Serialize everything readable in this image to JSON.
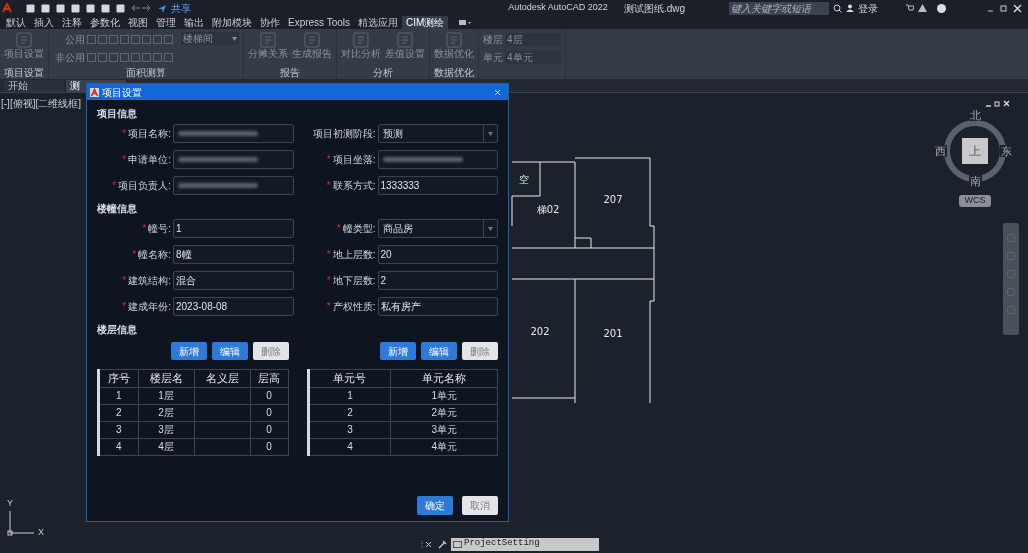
{
  "app": {
    "title": "Autodesk AutoCAD 2022",
    "file_name": "测试图纸.dwg",
    "share": "共享",
    "search": {
      "placeholder": "键入关键字或短语"
    },
    "login": "登录"
  },
  "ribbon_tabs": [
    {
      "label": "默认",
      "selected": false
    },
    {
      "label": "插入",
      "selected": false
    },
    {
      "label": "注释",
      "selected": false
    },
    {
      "label": "参数化",
      "selected": false
    },
    {
      "label": "视图",
      "selected": false
    },
    {
      "label": "管理",
      "selected": false
    },
    {
      "label": "输出",
      "selected": false
    },
    {
      "label": "附加模块",
      "selected": false
    },
    {
      "label": "协作",
      "selected": false
    },
    {
      "label": "Express Tools",
      "selected": false
    },
    {
      "label": "精选应用",
      "selected": false
    },
    {
      "label": "CIM测绘",
      "selected": true
    }
  ],
  "ribbon_panels": [
    {
      "kind": "buttons",
      "title": "项目设置",
      "buttons": [
        "项目设置"
      ]
    },
    {
      "kind": "area",
      "title": "面积测算",
      "rows": [
        "公用",
        "非公用"
      ],
      "dropdown": "楼梯间"
    },
    {
      "kind": "buttons",
      "title": "报告",
      "buttons": [
        "分摊关系",
        "生成报告"
      ]
    },
    {
      "kind": "buttons",
      "title": "分析",
      "buttons": [
        "对比分析",
        "差值设置"
      ]
    },
    {
      "kind": "buttons",
      "title": "数据优化",
      "buttons": [
        "数据优化"
      ]
    },
    {
      "kind": "selectors",
      "selectors": [
        {
          "label": "楼层",
          "value": "4层"
        },
        {
          "label": "单元",
          "value": "4单元"
        }
      ]
    }
  ],
  "file_tabs": [
    {
      "label": "开始",
      "selected": false
    },
    {
      "label": "测",
      "selected": true
    }
  ],
  "viewport_label": "[-][俯视][二维线框]",
  "drawing": {
    "rooms": [
      "空",
      "梯02",
      "207",
      "202",
      "201"
    ]
  },
  "viewcube": {
    "north": "北",
    "south": "南",
    "east": "东",
    "west": "西",
    "face": "上",
    "ucs": "WCS"
  },
  "dialog": {
    "title": "项目设置",
    "required_mark": "*",
    "sections": [
      {
        "title": "项目信息",
        "fields": [
          {
            "label": "项目名称:",
            "required": true,
            "kind": "blurred"
          },
          {
            "label": "项目初测阶段:",
            "required": false,
            "kind": "select",
            "value": "预测"
          },
          {
            "label": "申请单位:",
            "required": true,
            "kind": "blurred"
          },
          {
            "label": "项目坐落:",
            "required": true,
            "kind": "blurred"
          },
          {
            "label": "项目负责人:",
            "required": true,
            "kind": "blurred"
          },
          {
            "label": "联系方式:",
            "required": true,
            "kind": "text",
            "value": "1333333"
          }
        ]
      },
      {
        "title": "楼幢信息",
        "fields": [
          {
            "label": "幢号:",
            "required": true,
            "kind": "text",
            "value": "1"
          },
          {
            "label": "幢类型:",
            "required": true,
            "kind": "select",
            "value": "商品房"
          },
          {
            "label": "幢名称:",
            "required": true,
            "kind": "text",
            "value": "8幢"
          },
          {
            "label": "地上层数:",
            "required": true,
            "kind": "text",
            "value": "20"
          },
          {
            "label": "建筑结构:",
            "required": true,
            "kind": "text",
            "value": "混合"
          },
          {
            "label": "地下层数:",
            "required": true,
            "kind": "text",
            "value": "2"
          },
          {
            "label": "建成年份:",
            "required": true,
            "kind": "text",
            "value": "2023-08-08"
          },
          {
            "label": "产权性质:",
            "required": true,
            "kind": "text",
            "value": "私有房产"
          }
        ]
      }
    ],
    "floor_section": "楼层信息",
    "tables": [
      {
        "buttons": [
          {
            "label": "新增",
            "disabled": false
          },
          {
            "label": "编辑",
            "disabled": false
          },
          {
            "label": "删除",
            "disabled": true
          }
        ],
        "columns": [
          "序号",
          "楼层名",
          "名义层",
          "层高"
        ],
        "rows": [
          [
            "1",
            "1层",
            "",
            "0"
          ],
          [
            "2",
            "2层",
            "",
            "0"
          ],
          [
            "3",
            "3层",
            "",
            "0"
          ],
          [
            "4",
            "4层",
            "",
            "0"
          ]
        ]
      },
      {
        "buttons": [
          {
            "label": "新增",
            "disabled": false
          },
          {
            "label": "编辑",
            "disabled": false
          },
          {
            "label": "删除",
            "disabled": true
          }
        ],
        "columns": [
          "单元号",
          "单元名称"
        ],
        "rows": [
          [
            "1",
            "1单元"
          ],
          [
            "2",
            "2单元"
          ],
          [
            "3",
            "3单元"
          ],
          [
            "4",
            "4单元"
          ]
        ]
      }
    ],
    "footer_buttons": [
      {
        "label": "确定",
        "disabled": false
      },
      {
        "label": "取消",
        "disabled": true
      }
    ]
  },
  "ucs": {
    "x": "X",
    "y": "Y"
  },
  "command_line": "ProjectSetting"
}
